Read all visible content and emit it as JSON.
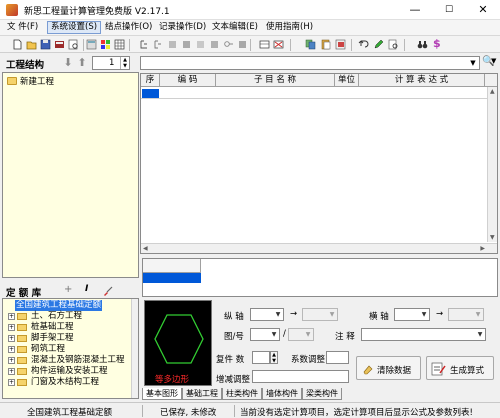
{
  "window": {
    "title": "新思工程量计算管理免费版 V2.17.1",
    "controls": [
      "—",
      "☐",
      "✕"
    ]
  },
  "menu": {
    "items": [
      "文 件(F)",
      "系统设置(S)",
      "结点操作(O)",
      "记录操作(D)",
      "文本编辑(E)",
      "使用指南(H)"
    ]
  },
  "project": {
    "header": "工程结构",
    "level": "1",
    "root_node": "新建工程"
  },
  "grid": {
    "columns": [
      "序",
      "编 码",
      "子 目 名 称",
      "单位",
      "计 算 表 达 式"
    ]
  },
  "library": {
    "header": "定 额 库",
    "root": "全国建筑工程基础定额",
    "items": [
      "土、石方工程",
      "桩基础工程",
      "脚手架工程",
      "砌筑工程",
      "混凝土及钢筋混凝土工程",
      "构件运输及安装工程",
      "门窗及木结构工程"
    ]
  },
  "shape": {
    "caption": "等多边形"
  },
  "form": {
    "vertical_axis": "纵 轴",
    "horizontal_axis": "横 轴",
    "arrow": "→",
    "figure_no": "图/号",
    "slash": "/",
    "note": "注 释",
    "count": "复件 数",
    "coef": "系数调整",
    "adjust": "增减调整",
    "clear_button": "清除数据",
    "generate_button": "生成算式"
  },
  "tabs": [
    "基本图形",
    "基础工程",
    "柱类构件",
    "墙体构件",
    "梁类构件"
  ],
  "status": {
    "library": "全国建筑工程基础定额",
    "saved": "已保存, 未修改",
    "message": "当前没有选定计算项目，选定计算项目后显示公式及参数列表!"
  },
  "colors": {
    "tree_bg": "#ffffe1",
    "selection": "#0058d8",
    "shape_bg": "#000000",
    "shape_line": "#32cd32",
    "caption": "#ff2a2a"
  }
}
